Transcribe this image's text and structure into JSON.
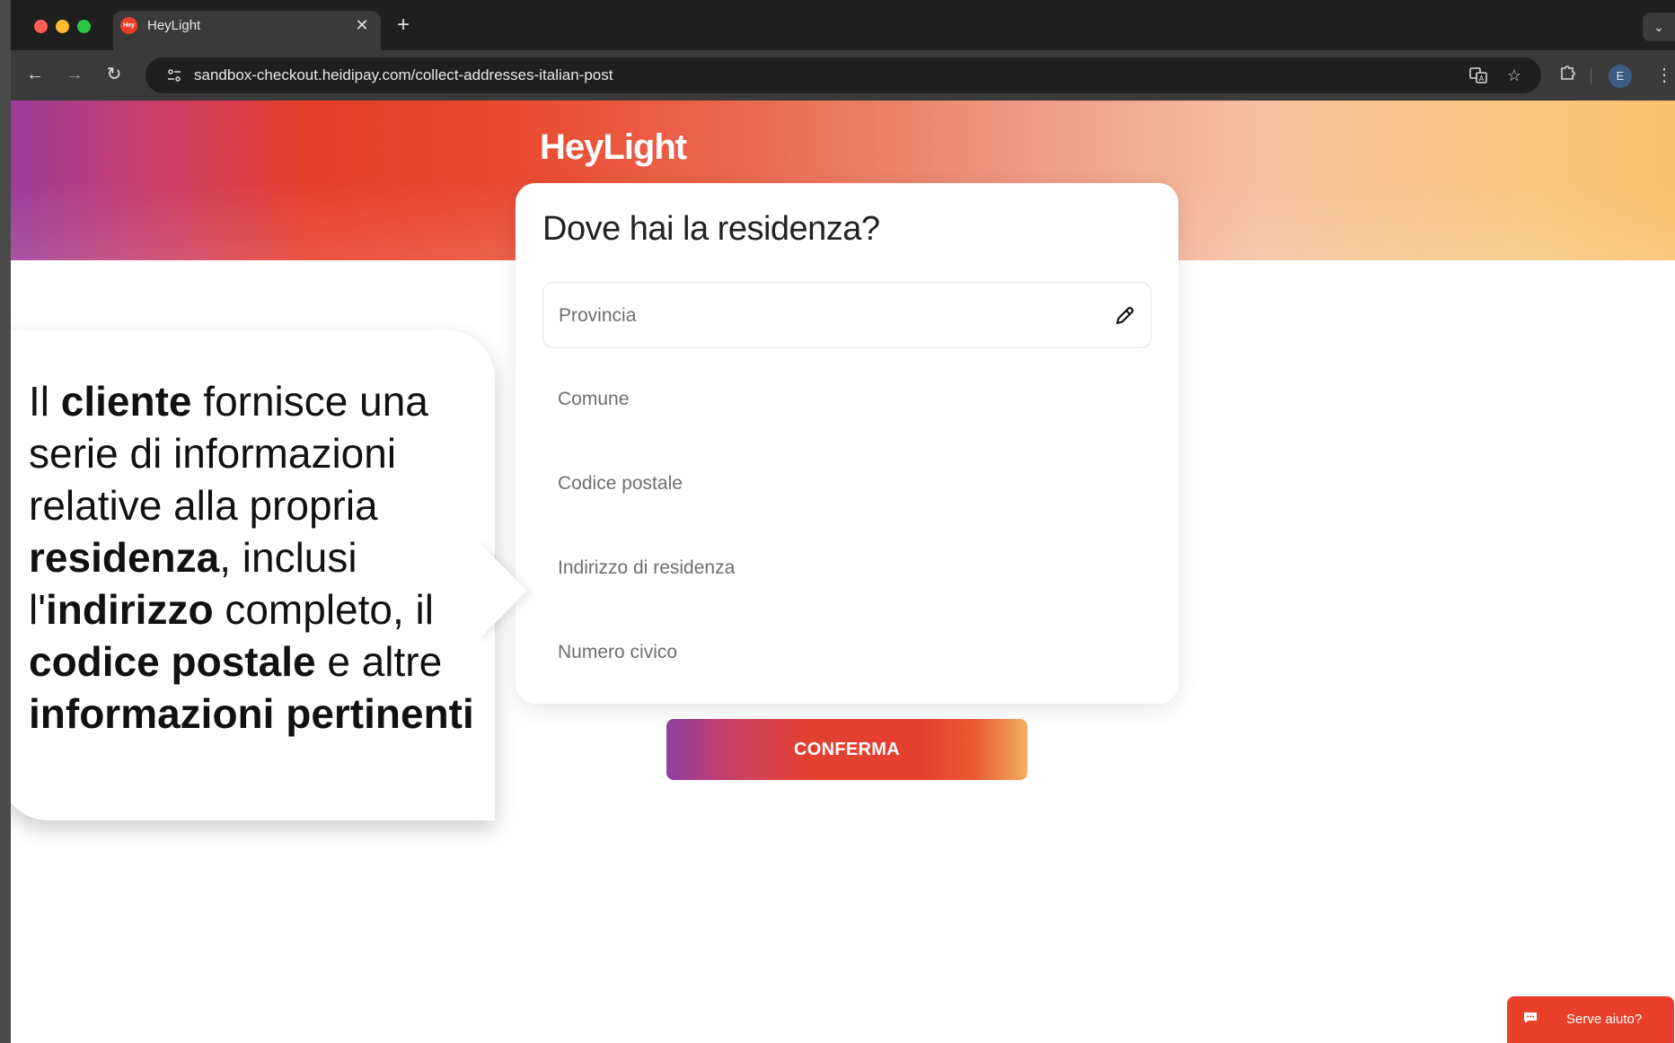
{
  "browser": {
    "tab_title": "HeyLight",
    "tab_favicon_text": "Hey",
    "url": "sandbox-checkout.heidipay.com/collect-addresses-italian-post",
    "profile_initial": "E",
    "icons": {
      "close_window": "close-dot",
      "minimize": "minimize-dot",
      "maximize": "maximize-dot",
      "tab_close": "close-icon",
      "new_tab": "plus-icon",
      "tab_menu": "chevron-down-icon",
      "back": "arrow-left-icon",
      "forward": "arrow-right-icon",
      "reload": "reload-icon",
      "site_info": "tune-icon",
      "translate": "translate-icon",
      "bookmark": "star-icon",
      "extensions": "puzzle-icon",
      "menu": "kebab-icon"
    }
  },
  "page": {
    "logo": "HeyLight",
    "form": {
      "title": "Dove hai la residenza?",
      "fields": [
        {
          "label": "Provincia"
        },
        {
          "label": "Comune"
        },
        {
          "label": "Codice postale"
        },
        {
          "label": "Indirizzo di residenza"
        },
        {
          "label": "Numero civico"
        }
      ],
      "edit_icon": "pencil-icon"
    },
    "confirm_button": "CONFERMA",
    "help_button": "Serve aiuto?",
    "help_icon": "chat-icon"
  },
  "callout": {
    "t1": "Il ",
    "b1": "cliente",
    "t2": " fornisce una serie di informazioni relative alla propria ",
    "b2": "residenza",
    "t3": ", inclusi l'",
    "b3": "indirizzo",
    "t4": " completo, il ",
    "b4": "codice postale",
    "t5": " e altre ",
    "b5": "informazioni pertinenti"
  },
  "colors": {
    "brand_red": "#e8402b",
    "brand_purple": "#9b3c9a",
    "brand_orange": "#f6c26a"
  }
}
